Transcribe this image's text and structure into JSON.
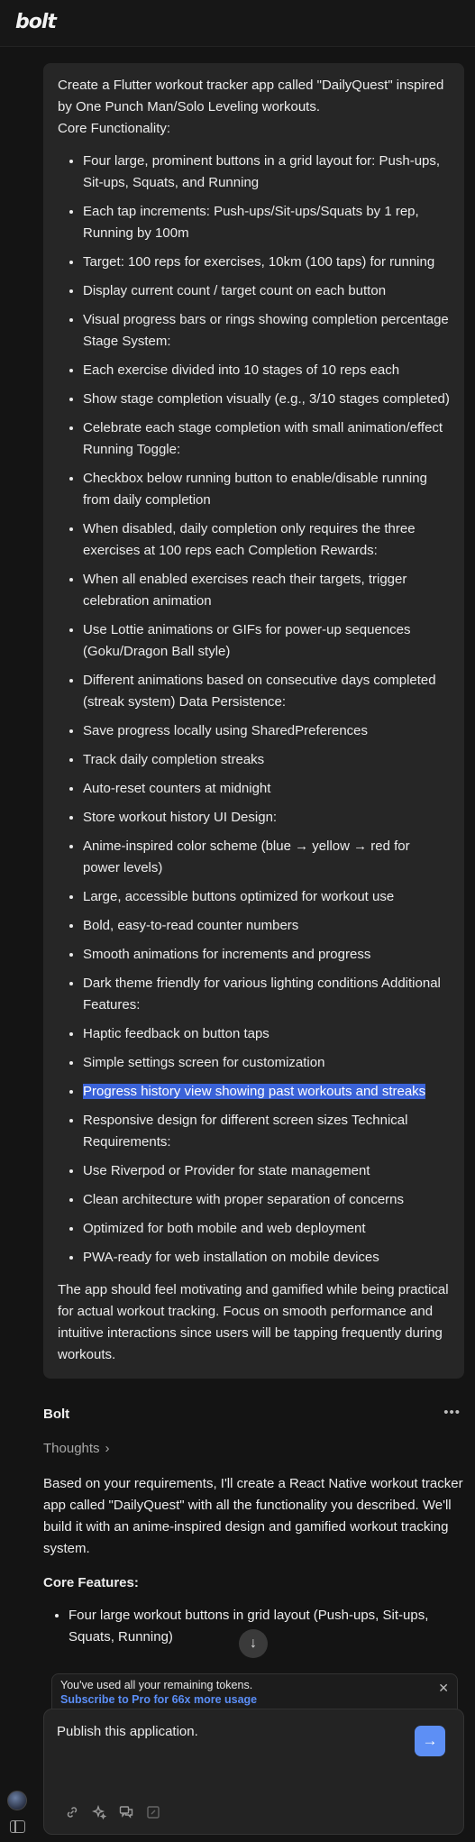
{
  "header": {
    "logo": "bolt"
  },
  "user_message": {
    "intro": "Create a Flutter workout tracker app called \"DailyQuest\" inspired by One Punch Man/Solo Leveling workouts.",
    "section": "Core Functionality:",
    "items": [
      "Four large, prominent buttons in a grid layout for: Push-ups, Sit-ups, Squats, and Running",
      "Each tap increments: Push-ups/Sit-ups/Squats by 1 rep, Running by 100m",
      "Target: 100 reps for exercises, 10km (100 taps) for running",
      "Display current count / target count on each button",
      "Visual progress bars or rings showing completion percentage Stage System:",
      "Each exercise divided into 10 stages of 10 reps each",
      "Show stage completion visually (e.g., 3/10 stages completed)",
      "Celebrate each stage completion with small animation/effect Running Toggle:",
      "Checkbox below running button to enable/disable running from daily completion",
      "When disabled, daily completion only requires the three exercises at 100 reps each Completion Rewards:",
      "When all enabled exercises reach their targets, trigger celebration animation",
      "Use Lottie animations or GIFs for power-up sequences (Goku/Dragon Ball style)",
      "Different animations based on consecutive days completed (streak system) Data Persistence:",
      "Save progress locally using SharedPreferences",
      "Track daily completion streaks",
      "Auto-reset counters at midnight",
      "Store workout history UI Design:",
      "Anime-inspired color scheme (blue → yellow → red for power levels)",
      "Large, accessible buttons optimized for workout use",
      "Bold, easy-to-read counter numbers",
      "Smooth animations for increments and progress",
      "Dark theme friendly for various lighting conditions Additional Features:",
      "Haptic feedback on button taps",
      "Simple settings screen for customization",
      "Progress history view showing past workouts and streaks",
      "Responsive design for different screen sizes Technical Requirements:",
      "Use Riverpod or Provider for state management",
      "Clean architecture with proper separation of concerns",
      "Optimized for both mobile and web deployment",
      "PWA-ready for web installation on mobile devices"
    ],
    "outro": "The app should feel motivating and gamified while being practical for actual workout tracking. Focus on smooth performance and intuitive interactions since users will be tapping frequently during workouts."
  },
  "assistant": {
    "name": "Bolt",
    "more_icon": "more-horizontal-icon",
    "thoughts_label": "Thoughts",
    "reply": "Based on your requirements, I'll create a React Native workout tracker app called \"DailyQuest\" with all the functionality you described. We'll build it with an anime-inspired design and gamified workout tracking system.",
    "core_heading": "Core Features:",
    "core_items": [
      "Four large workout buttons in grid layout (Push-ups, Sit-ups, Squats, Running)"
    ]
  },
  "banner": {
    "message": "You've used all your remaining tokens.",
    "link": "Subscribe to Pro for 66x more usage"
  },
  "composer": {
    "value": "Publish this application."
  },
  "colors": {
    "accent": "#5d8ff5",
    "highlight": "#3b63d8",
    "background": "#141414",
    "bubble": "#262626"
  }
}
